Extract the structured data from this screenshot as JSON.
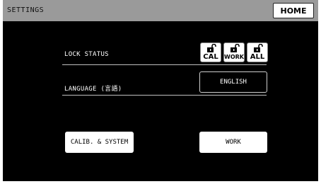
{
  "header": {
    "title": "SETTINGS",
    "home_label": "HOME"
  },
  "lock": {
    "label": "LOCK STATUS",
    "items": [
      {
        "label": "CAL",
        "icon": "unlocked-padlock-icon"
      },
      {
        "label": "WORK",
        "icon": "unlocked-padlock-icon"
      },
      {
        "label": "ALL",
        "icon": "unlocked-padlock-icon"
      }
    ]
  },
  "language": {
    "label": "LANGUAGE (言語)",
    "value": "ENGLISH"
  },
  "buttons": {
    "calib": "CALIB. & SYSTEM",
    "work": "WORK"
  },
  "colors": {
    "background": "#000000",
    "titlebar": "#9a9a9a",
    "button": "#ffffff"
  }
}
